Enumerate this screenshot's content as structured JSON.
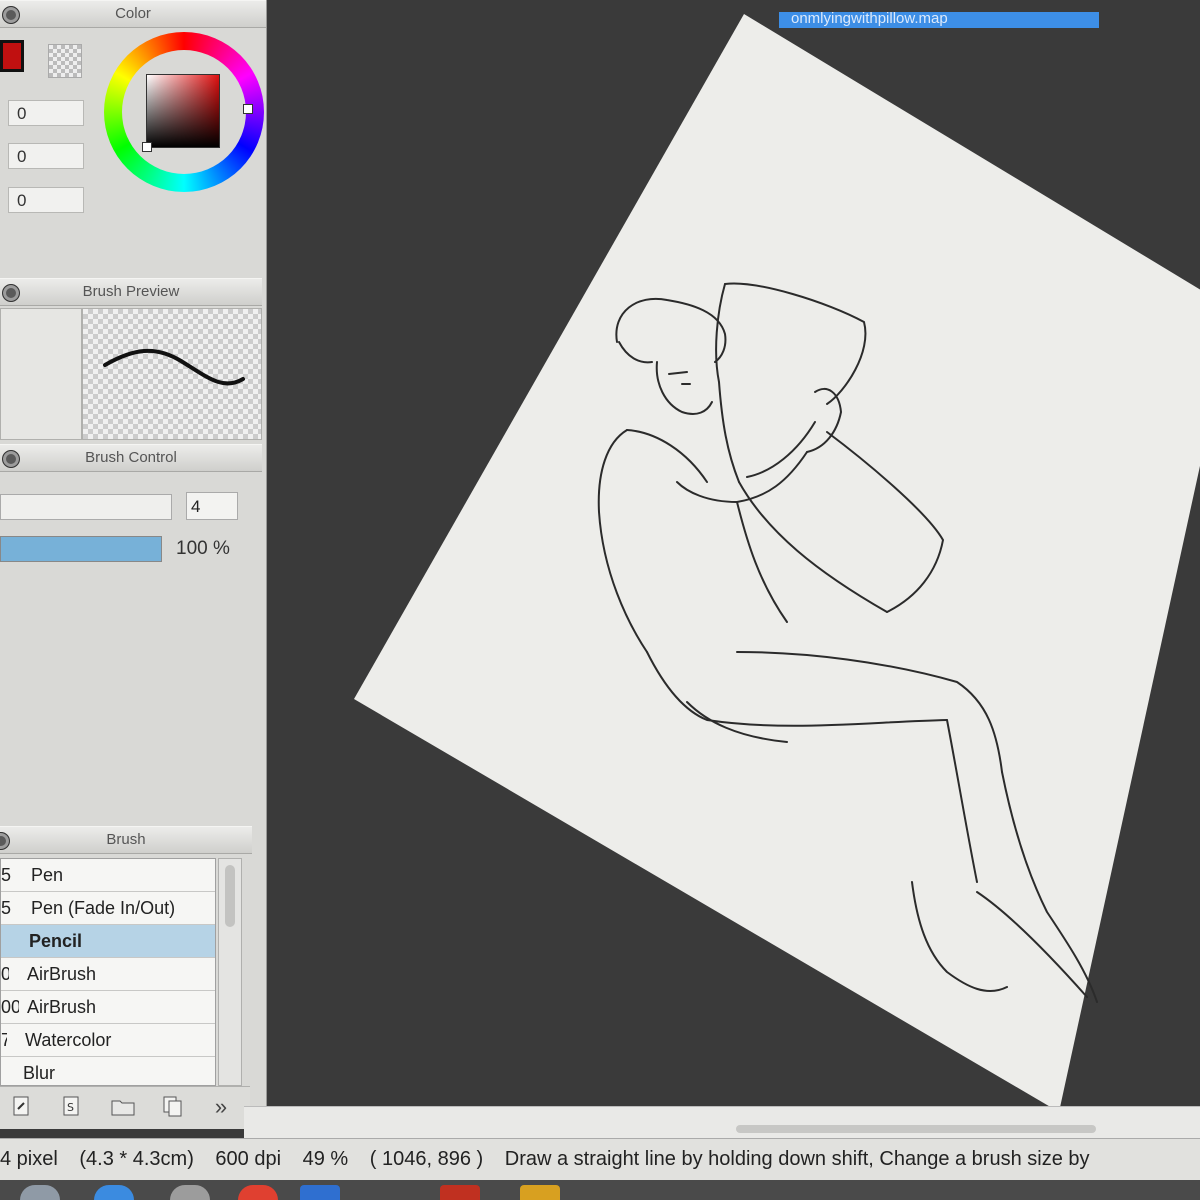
{
  "panels": {
    "color_title": "Color",
    "brush_preview_title": "Brush Preview",
    "brush_control_title": "Brush Control",
    "brush_title": "Brush"
  },
  "color": {
    "inputs": [
      "0",
      "0",
      "0"
    ],
    "foreground_color": "#c01010"
  },
  "brush_control": {
    "size_value": "4",
    "density_label": "100 %",
    "density_fraction": 1.0
  },
  "brush_list": {
    "items": [
      {
        "size": "5",
        "name": "Pen"
      },
      {
        "size": "5",
        "name": "Pen (Fade In/Out)"
      },
      {
        "size": "",
        "name": "Pencil"
      },
      {
        "size": "0",
        "name": "AirBrush"
      },
      {
        "size": "00",
        "name": "AirBrush"
      },
      {
        "size": "7",
        "name": "Watercolor"
      },
      {
        "size": "",
        "name": "Blur"
      }
    ],
    "selected": "Pencil"
  },
  "toolbar": {
    "icons": [
      "new-brush-icon",
      "special-brush-icon",
      "folder-icon",
      "copy-icon",
      "more-icon"
    ],
    "more_label": "»"
  },
  "document": {
    "tab_title": "onmlyingwithpillow.map"
  },
  "status": {
    "size": "4 pixel",
    "dimensions": "(4.3 * 4.3cm)",
    "dpi": "600 dpi",
    "zoom": "49 %",
    "coords": "( 1046, 896 )",
    "hint": "Draw a straight line by holding down shift, Change a brush size by"
  },
  "colors": {
    "accent": "#3d8ee6",
    "selection": "#b6d3e6",
    "density_fill": "#77b1d8"
  }
}
